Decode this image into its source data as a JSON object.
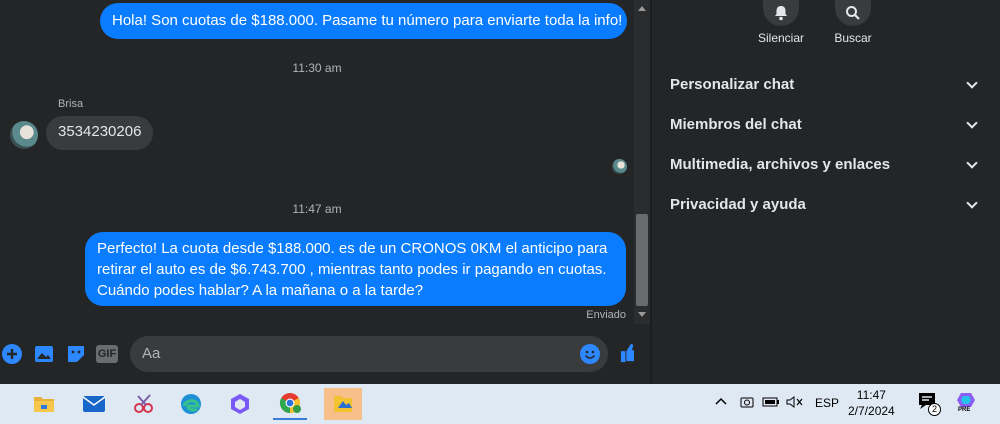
{
  "messages": {
    "outgoing_1": "Hola! Son cuotas de $188.000. Pasame tu número para enviarte toda la info!",
    "time_1": "11:30 am",
    "sender": "Brisa",
    "incoming_1": "3534230206",
    "time_2": "11:47 am",
    "outgoing_2": "Perfecto! La cuota desde $188.000. es de un CRONOS 0KM el anticipo para retirar el auto es de $6.743.700 , mientras tanto podes ir pagando en cuotas. Cuándo podes hablar? A la mañana o a la tarde?",
    "status": "Enviado"
  },
  "composer": {
    "placeholder": "Aa",
    "gif_label": "GIF"
  },
  "sidebar": {
    "mute_label": "Silenciar",
    "search_label": "Buscar",
    "sections": [
      "Personalizar chat",
      "Miembros del chat",
      "Multimedia, archivos y enlaces",
      "Privacidad y ayuda"
    ]
  },
  "taskbar": {
    "lang": "ESP",
    "time": "11:47",
    "date": "2/7/2024",
    "notif_count": "2",
    "copilot_badge": "PRE"
  },
  "colors": {
    "accent": "#0a7cff",
    "background": "#242526",
    "bubble_in": "#3a3b3c"
  }
}
